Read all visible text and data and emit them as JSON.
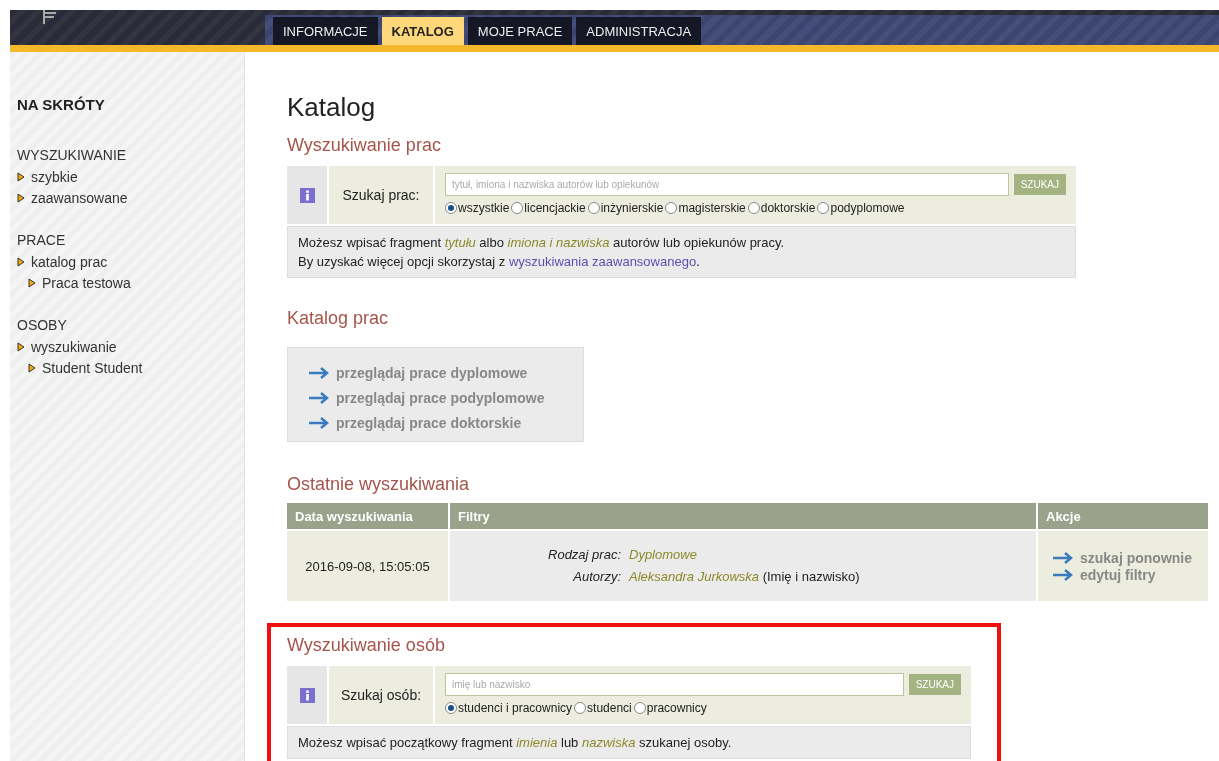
{
  "nav": {
    "tabs": [
      {
        "label": "INFORMACJE",
        "selected": false
      },
      {
        "label": "KATALOG",
        "selected": true
      },
      {
        "label": "MOJE PRACE",
        "selected": false
      },
      {
        "label": "ADMINISTRACJA",
        "selected": false
      }
    ]
  },
  "sidebar": {
    "title": "NA SKRÓTY",
    "groups": [
      {
        "heading": "WYSZUKIWANIE",
        "items": [
          {
            "label": "szybkie"
          },
          {
            "label": "zaawansowane"
          }
        ]
      },
      {
        "heading": "PRACE",
        "items": [
          {
            "label": "katalog prac",
            "children": [
              {
                "label": "Praca testowa"
              }
            ]
          }
        ]
      },
      {
        "heading": "OSOBY",
        "items": [
          {
            "label": "wyszukiwanie",
            "children": [
              {
                "label": "Student Student"
              }
            ]
          }
        ]
      }
    ]
  },
  "page_title": "Katalog",
  "work_search": {
    "heading": "Wyszukiwanie prac",
    "label": "Szukaj prac:",
    "placeholder": "tytuł, imiona i nazwiska autorów lub opiekunów",
    "button": "SZUKAJ",
    "options": [
      {
        "label": "wszystkie",
        "selected": true
      },
      {
        "label": "licencjackie",
        "selected": false
      },
      {
        "label": "inżynierskie",
        "selected": false
      },
      {
        "label": "magisterskie",
        "selected": false
      },
      {
        "label": "doktorskie",
        "selected": false
      },
      {
        "label": "podyplomowe",
        "selected": false
      }
    ],
    "hint": "Możesz wpisać fragment *tytułu* albo *imiona i nazwiska* autorów lub opiekunów pracy.",
    "hint2": {
      "before": "By uzyskać więcej opcji skorzystaj z",
      "link": "wyszukiwania zaawansowanego",
      "after": "."
    }
  },
  "catalog": {
    "heading": "Katalog prac",
    "links": [
      "przeglądaj prace dyplomowe",
      "przeglądaj prace podyplomowe",
      "przeglądaj prace doktorskie"
    ]
  },
  "recent": {
    "heading": "Ostatnie wyszukiwania",
    "columns": [
      "Data wyszukiwania",
      "Filtry",
      "Akcje"
    ],
    "rows": [
      {
        "date": "2016-09-08, 15:05:05",
        "filters": [
          {
            "label": "Rodzaj prac:",
            "value": "Dyplomowe"
          },
          {
            "label": "Autorzy:",
            "value": "Aleksandra Jurkowska",
            "note": "(Imię i nazwisko)"
          }
        ],
        "actions": [
          "szukaj ponownie",
          "edytuj filtry"
        ]
      }
    ]
  },
  "person_search": {
    "heading": "Wyszukiwanie osób",
    "label": "Szukaj osób:",
    "placeholder": "imię lub nazwisko",
    "button": "SZUKAJ",
    "options": [
      {
        "label": "studenci i pracownicy",
        "selected": true
      },
      {
        "label": "studenci",
        "selected": false
      },
      {
        "label": "pracownicy",
        "selected": false
      }
    ],
    "hint": "Możesz wpisać początkowy fragment *imienia* lub *nazwiska* szukanej osoby."
  }
}
